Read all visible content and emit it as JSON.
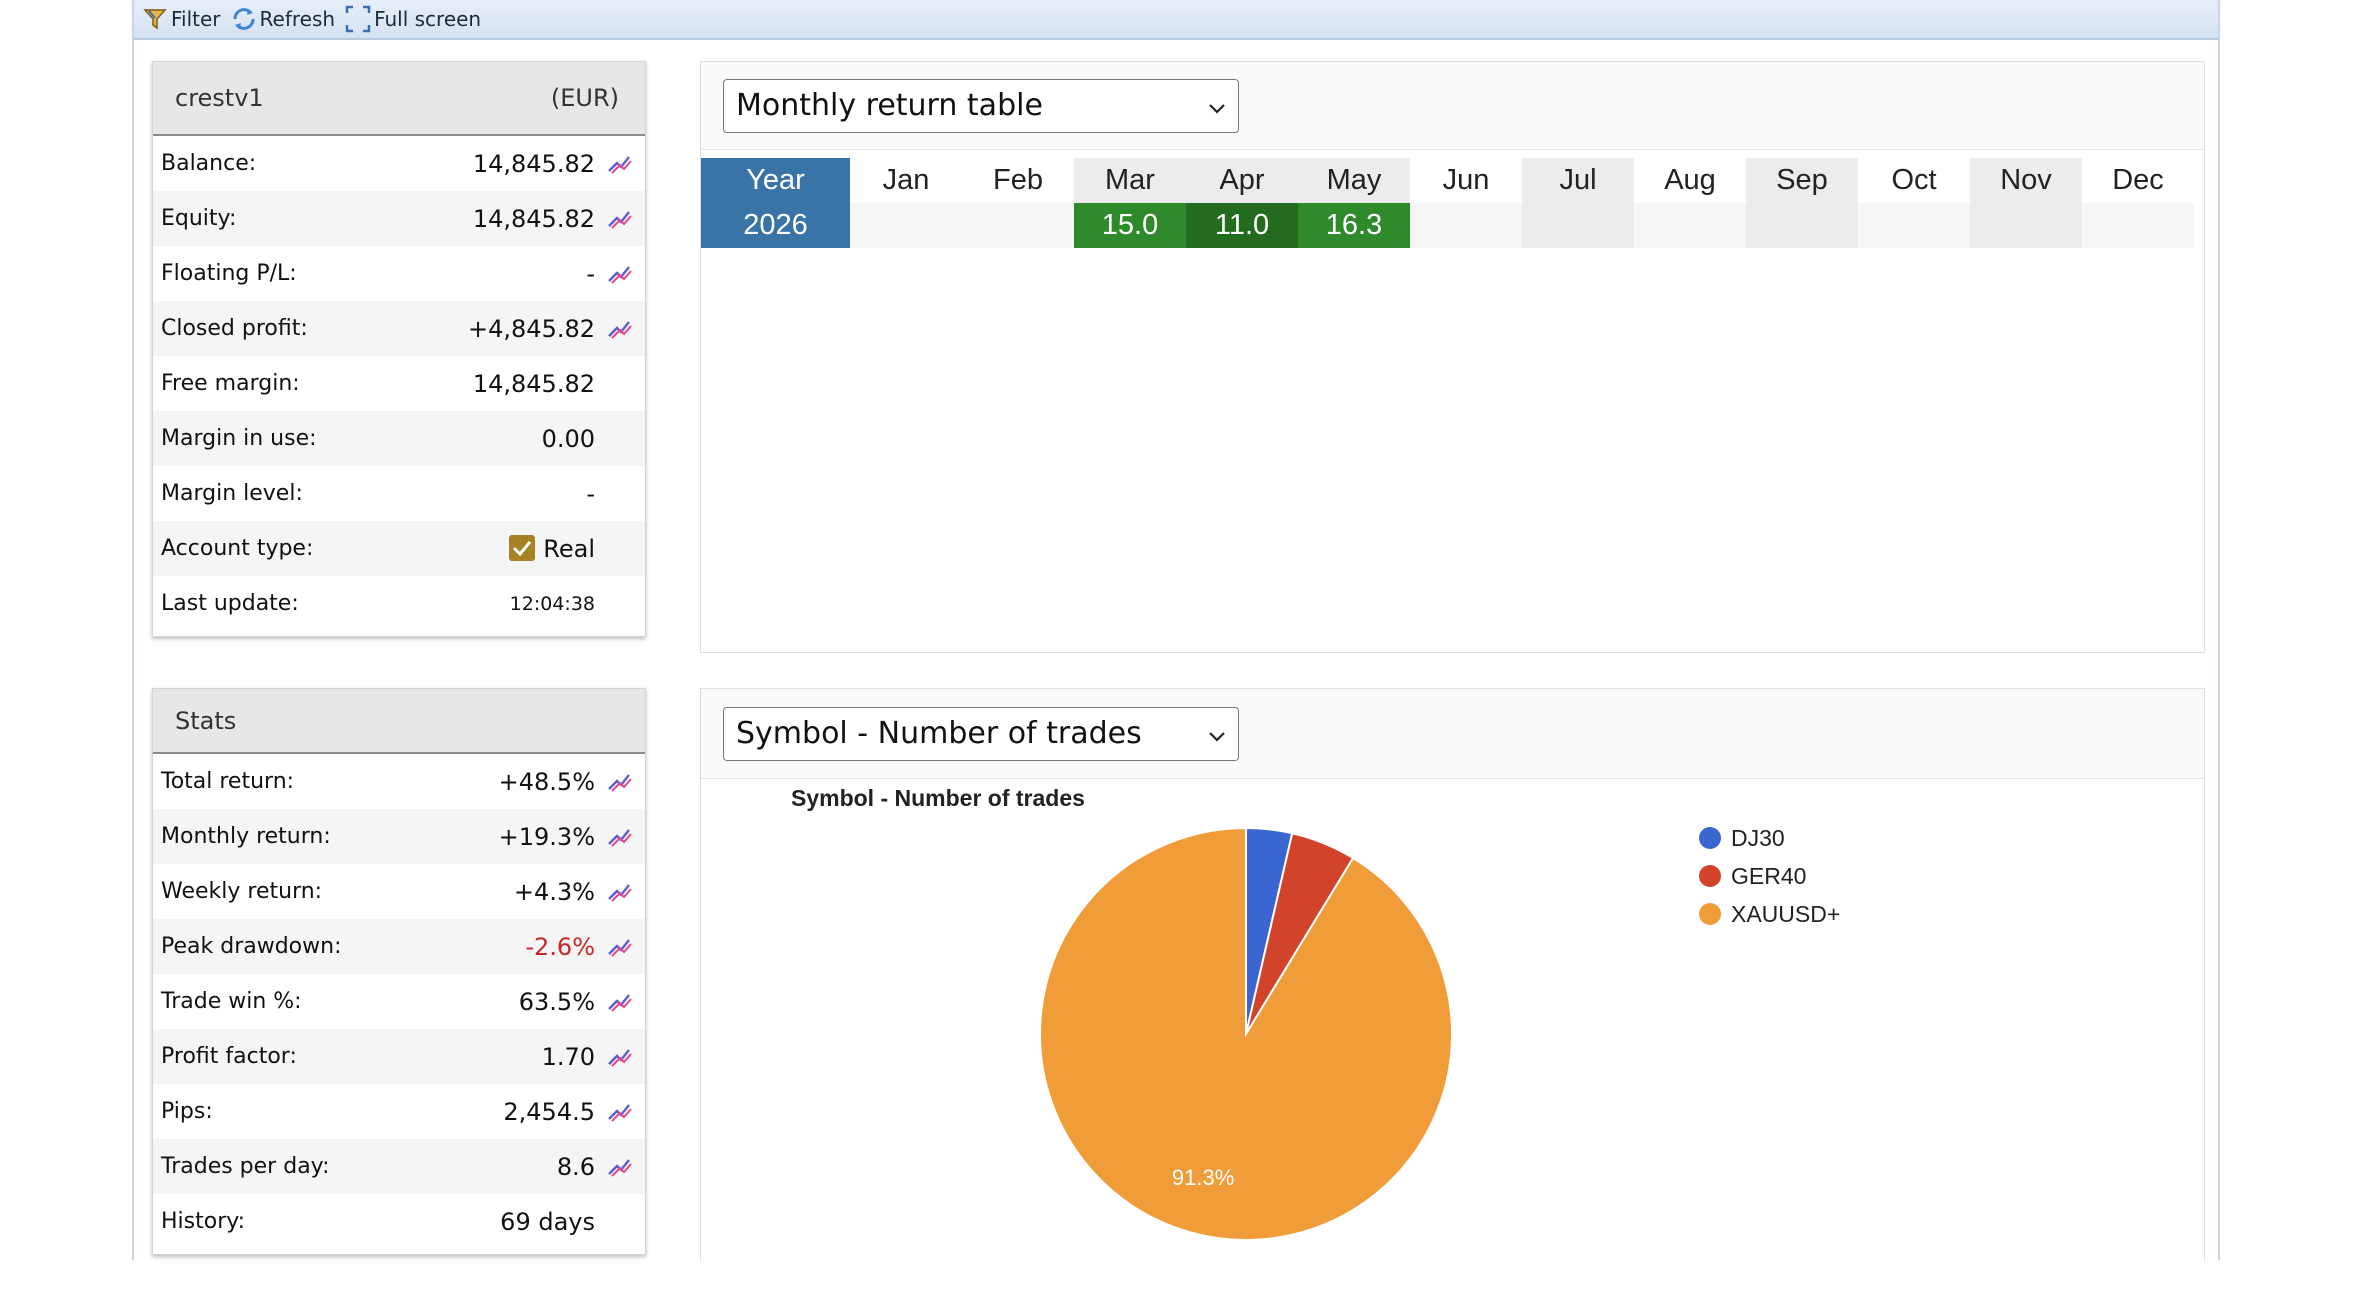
{
  "toolbar": {
    "filter": "Filter",
    "refresh": "Refresh",
    "fullscreen": "Full screen"
  },
  "account": {
    "name": "crestv1",
    "currency": "(EUR)",
    "rows": [
      {
        "label": "Balance:",
        "value": "14,845.82"
      },
      {
        "label": "Equity:",
        "value": "14,845.82"
      },
      {
        "label": "Floating P/L:",
        "value": "-"
      },
      {
        "label": "Closed profit:",
        "value": "+4,845.82"
      },
      {
        "label": "Free margin:",
        "value": "14,845.82"
      },
      {
        "label": "Margin in use:",
        "value": "0.00"
      },
      {
        "label": "Margin level:",
        "value": "-"
      },
      {
        "label": "Account type:",
        "value": "Real"
      },
      {
        "label": "Last update:",
        "value": "12:04:38"
      }
    ]
  },
  "stats": {
    "title": "Stats",
    "rows": [
      {
        "label": "Total return:",
        "value": "+48.5%"
      },
      {
        "label": "Monthly return:",
        "value": "+19.3%"
      },
      {
        "label": "Weekly return:",
        "value": "+4.3%"
      },
      {
        "label": "Peak drawdown:",
        "value": "-2.6%"
      },
      {
        "label": "Trade win %:",
        "value": "63.5%"
      },
      {
        "label": "Profit factor:",
        "value": "1.70"
      },
      {
        "label": "Pips:",
        "value": "2,454.5"
      },
      {
        "label": "Trades per day:",
        "value": "8.6"
      },
      {
        "label": "History:",
        "value": "69 days"
      }
    ]
  },
  "monthly": {
    "select": "Monthly return table",
    "header": [
      "Year",
      "Jan",
      "Feb",
      "Mar",
      "Apr",
      "May",
      "Jun",
      "Jul",
      "Aug",
      "Sep",
      "Oct",
      "Nov",
      "Dec"
    ],
    "row": [
      "2026",
      "",
      "",
      "15.0",
      "11.0",
      "16.3",
      "",
      "",
      "",
      "",
      "",
      "",
      ""
    ]
  },
  "symbol_panel": {
    "select": "Symbol - Number of trades"
  },
  "chart_data": {
    "type": "pie",
    "title": "Symbol - Number of trades",
    "categories": [
      "DJ30",
      "GER40",
      "XAUUSD+"
    ],
    "values": [
      3.6,
      5.1,
      91.3
    ],
    "colors": [
      "#3a66d1",
      "#d2432b",
      "#f09c38"
    ],
    "data_labels": [
      "",
      "",
      "91.3%"
    ],
    "legend": "right"
  },
  "colors": {
    "year_header": "#3a74a7",
    "positive_month": "#2f8a2b",
    "negative_text": "#c62828",
    "toolbar_bg": "#dbe6f3"
  }
}
